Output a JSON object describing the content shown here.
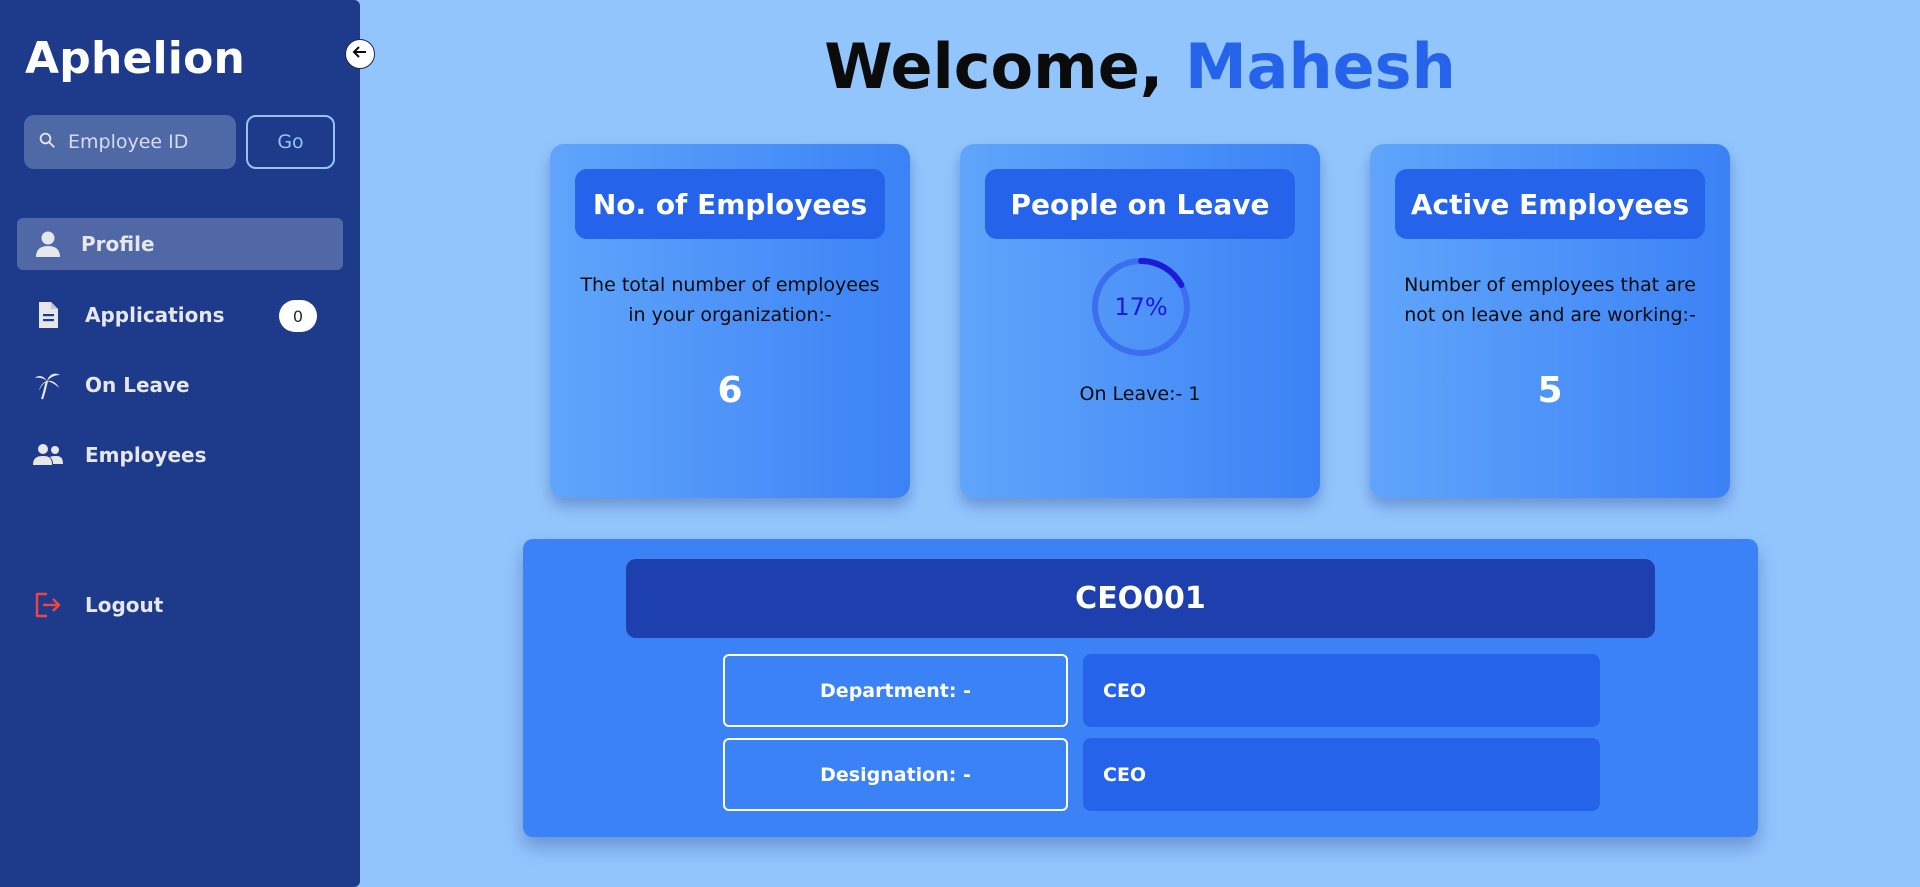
{
  "sidebar": {
    "brand": "Aphelion",
    "search": {
      "placeholder": "Employee ID",
      "value": ""
    },
    "go_label": "Go",
    "items": [
      {
        "label": "Profile",
        "icon": "user-icon",
        "active": true
      },
      {
        "label": "Applications",
        "icon": "document-icon",
        "badge": "0"
      },
      {
        "label": "On Leave",
        "icon": "palm-tree-icon"
      },
      {
        "label": "Employees",
        "icon": "users-icon"
      }
    ],
    "logout_label": "Logout"
  },
  "header": {
    "greeting": "Welcome,",
    "user_name": "Mahesh"
  },
  "cards": {
    "employees": {
      "title": "No. of Employees",
      "description": "The total number of employees in your organization:-",
      "value": "6"
    },
    "leave": {
      "title": "People on Leave",
      "percent": 17,
      "percent_label": "17%",
      "count_label": "On Leave:- 1"
    },
    "active": {
      "title": "Active Employees",
      "description": "Number of employees that are not on leave and are working:-",
      "value": "5"
    }
  },
  "detail": {
    "employee_id": "CEO001",
    "fields": [
      {
        "label": "Department: -",
        "value": "CEO"
      },
      {
        "label": "Designation: -",
        "value": "CEO"
      }
    ]
  },
  "colors": {
    "sidebar": "#1e3a8a",
    "background": "#93c5fd",
    "accent": "#2563eb",
    "progress": "#1d1ad8",
    "logout_icon": "#ef4444"
  }
}
